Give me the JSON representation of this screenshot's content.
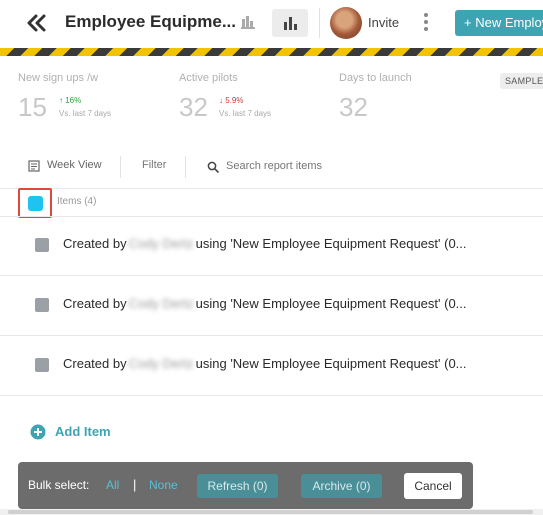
{
  "header": {
    "title": "Employee Equipme...",
    "invite_label": "Invite",
    "new_button_label": "+ New Employ"
  },
  "stats": [
    {
      "label": "New sign ups /w",
      "value": "15",
      "change": "↑ 16%",
      "direction": "up",
      "comparison": "Vs. last 7 days"
    },
    {
      "label": "Active pilots",
      "value": "32",
      "change": "↓ 5.9%",
      "direction": "down",
      "comparison": "Vs. last 7 days"
    },
    {
      "label": "Days to launch",
      "value": "32"
    }
  ],
  "sample_badge": "SAMPLE",
  "toolbar": {
    "week_view_label": "Week View",
    "filter_label": "Filter",
    "search_placeholder": "Search report items"
  },
  "items": {
    "count_label": "Items (4)",
    "rows": [
      {
        "prefix": "Created by",
        "name": "Cody Dertz",
        "suffix": "using 'New Employee Equipment Request' (0..."
      },
      {
        "prefix": "Created by",
        "name": "Cody Dertz",
        "suffix": "using 'New Employee Equipment Request' (0..."
      },
      {
        "prefix": "Created by",
        "name": "Cody Dertz",
        "suffix": "using 'New Employee Equipment Request' (0..."
      }
    ],
    "add_label": "Add Item"
  },
  "bulk": {
    "label": "Bulk select:",
    "all_label": "All",
    "separator": "|",
    "none_label": "None",
    "refresh_label": "Refresh (0)",
    "archive_label": "Archive (0)",
    "cancel_label": "Cancel"
  },
  "colors": {
    "accent": "#3ea3b3",
    "select_all": "#20c2ef",
    "highlight": "#e0483e",
    "hazard_yellow": "#f2c300"
  }
}
